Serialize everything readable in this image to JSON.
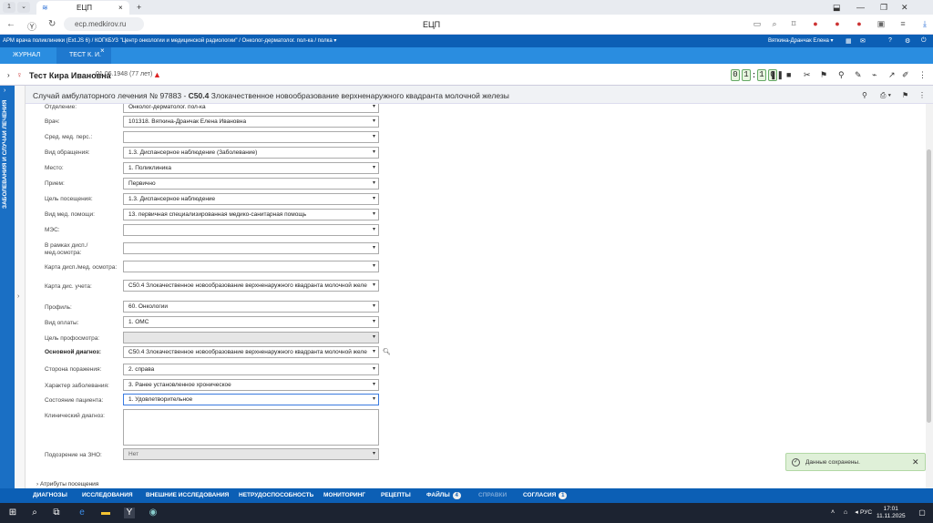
{
  "browser": {
    "tab_count": "1",
    "tab_title": "ЕЦП",
    "url": "ecp.medkirov.ru",
    "page_title": "ЕЦП"
  },
  "appbar": {
    "path": "АРМ врача поликлиники (Ext.JS 6) / КОГКБУЗ \"Центр онкологии и медицинской радиологии\" / Онколог-дерматолог. пол-ка / полка ▾",
    "user": "Вяткина-Дранчак Елена ▾"
  },
  "tabs": {
    "journal": "Журнал",
    "patient": "Тест К. И.",
    "patient_close": "×"
  },
  "patient": {
    "name": "Тест Кира Ивановна",
    "dob": "01.06.1948 (77 лет)",
    "timer": [
      "0",
      "1",
      "1",
      "0"
    ]
  },
  "sidestrip": {
    "label": "ЗАБОЛЕВАНИЯ И СЛУЧАИ ЛЕЧЕНИЯ"
  },
  "case": {
    "prefix": "Случай амбулаторного лечения № 97883 -",
    "code": "C50.4",
    "text": "Злокачественное новообразование верхненаружного квадранта молочной железы"
  },
  "form": {
    "rows": [
      {
        "label": "Отделение:",
        "value": "Онколог-дерматолог. пол-ка"
      },
      {
        "label": "Врач:",
        "value": "101318. Вяткина-Дранчак Елена Ивановна"
      },
      {
        "label": "Сред. мед. перс.:",
        "value": ""
      },
      {
        "label": "Вид обращения:",
        "value": "1.3. Диспансерное наблюдение (Заболевание)"
      },
      {
        "label": "Место:",
        "value": "1. Поликлиника"
      },
      {
        "label": "Прием:",
        "value": "Первично"
      },
      {
        "label": "Цель посещения:",
        "value": "1.3. Диспансерное наблюдение"
      },
      {
        "label": "Вид мед. помощи:",
        "value": "13. первичная специализированная медико-санитарная помощь"
      },
      {
        "label": "МЭС:",
        "value": ""
      },
      {
        "label": "В рамках дисп./ мед.осмотра:",
        "value": ""
      },
      {
        "label": "Карта дисп./мед. осмотра:",
        "value": ""
      },
      {
        "label": "Карта дис. учета:",
        "value": "C50.4 Злокачественное новообразование верхненаружного квадранта молочной желе"
      },
      {
        "label": "Профиль:",
        "value": "60. Онкологии"
      },
      {
        "label": "Вид оплаты:",
        "value": "1. ОМС"
      },
      {
        "label": "Цель профосмотра:",
        "value": ""
      },
      {
        "label": "Основной диагноз:",
        "value": "C50.4 Злокачественное новообразование верхненаружного квадранта молочной желе"
      },
      {
        "label": "Сторона поражения:",
        "value": "2. справа"
      },
      {
        "label": "Характер заболевания:",
        "value": "3. Ранее установленное хроническое"
      },
      {
        "label": "Состояние пациента:",
        "value": "1. Удовлетворительное"
      },
      {
        "label": "Клинический диагноз:",
        "value": ""
      },
      {
        "label": "Подозрение на ЗНО:",
        "value": "Нет"
      }
    ],
    "section": "Атрибуты посещения"
  },
  "toast": {
    "message": "Данные сохранены."
  },
  "bottomnav": {
    "items": [
      "Диагнозы",
      "Исследования",
      "Внешние исследования",
      "Нетрудоспособность",
      "Мониторинг",
      "Рецепты",
      "Файлы",
      "Справки",
      "Согласия"
    ],
    "files_count": "4",
    "consents_count": "1"
  },
  "taskbar": {
    "lang": "РУС",
    "time": "17:01",
    "date": "11.11.2025"
  }
}
